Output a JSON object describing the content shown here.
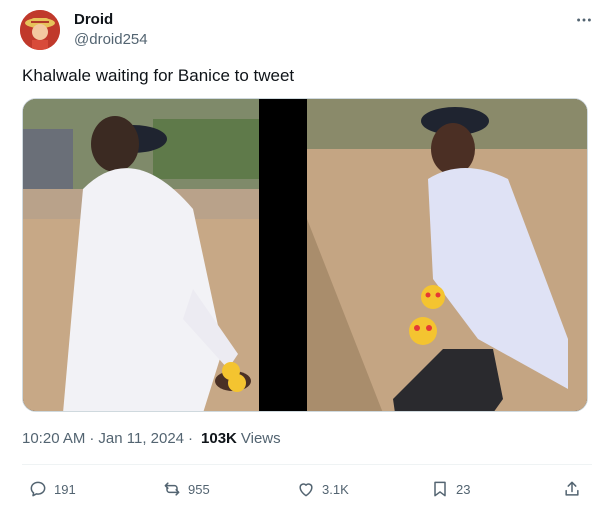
{
  "author": {
    "name": "Droid",
    "handle": "@droid254"
  },
  "tweet": {
    "text": "Khalwale waiting for Banice to tweet"
  },
  "meta": {
    "time": "10:20 AM",
    "separator1": "·",
    "date": "Jan 11, 2024",
    "separator2": "·",
    "views_count": "103K",
    "views_label": "Views"
  },
  "actions": {
    "replies": "191",
    "reposts": "955",
    "likes": "3.1K",
    "bookmarks": "23"
  },
  "icons": {
    "more": "more-horizontal-icon",
    "reply": "reply-icon",
    "repost": "repost-icon",
    "like": "heart-icon",
    "bookmark": "bookmark-icon",
    "share": "share-icon"
  },
  "colors": {
    "text_primary": "#0f1419",
    "text_secondary": "#536471",
    "border": "#cfd9de"
  }
}
